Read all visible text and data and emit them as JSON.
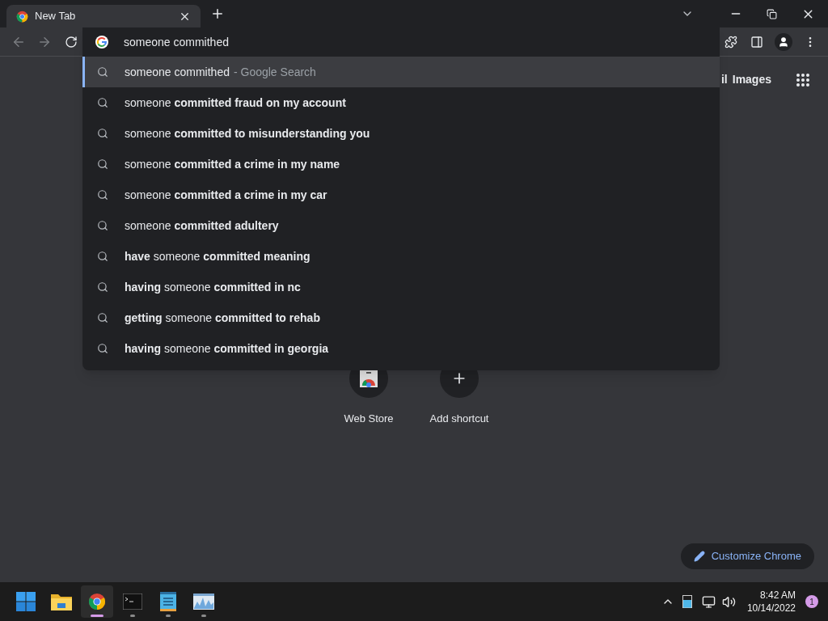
{
  "tab": {
    "title": "New Tab",
    "selected": true
  },
  "omnibox": {
    "value": "someone commithed"
  },
  "suggestions": [
    {
      "text": "someone commithed",
      "hint": "- Google Search",
      "selected": true
    },
    {
      "text": "someone **committed fraud on my account**",
      "selected": false
    },
    {
      "text": "someone **committed to misunderstanding you**",
      "selected": false
    },
    {
      "text": "someone **committed a crime in my name**",
      "selected": false
    },
    {
      "text": "someone **committed a crime in my car**",
      "selected": false
    },
    {
      "text": "someone **committed adultery**",
      "selected": false
    },
    {
      "text": "**have** someone **committed meaning**",
      "selected": false
    },
    {
      "text": "**having** someone **committed in nc**",
      "selected": false
    },
    {
      "text": "**getting** someone **committed to rehab**",
      "selected": false
    },
    {
      "text": "**having** someone **committed in georgia**",
      "selected": false
    }
  ],
  "header_links": [
    "il",
    "Images"
  ],
  "shortcuts": [
    {
      "kind": "webstore",
      "label": "Web Store"
    },
    {
      "kind": "add",
      "label": "Add shortcut"
    }
  ],
  "customize_button": "Customize Chrome",
  "taskbar": {
    "apps": [
      {
        "kind": "start",
        "active": false,
        "running": false
      },
      {
        "kind": "explorer",
        "active": false,
        "running": false
      },
      {
        "kind": "chrome",
        "active": true,
        "running": true
      },
      {
        "kind": "terminal",
        "active": false,
        "running": true
      },
      {
        "kind": "notepad",
        "active": false,
        "running": true
      },
      {
        "kind": "monitor",
        "active": false,
        "running": true
      }
    ],
    "time": "8:42 AM",
    "date": "10/14/2022",
    "notifications": "1"
  }
}
